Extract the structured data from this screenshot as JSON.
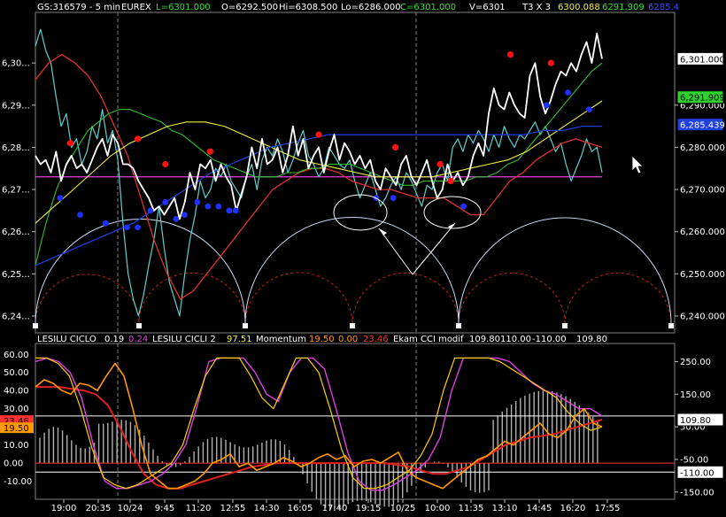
{
  "header": {
    "symbol": "GS:316579 - 5 min",
    "exchange": "EUREX",
    "last": "L=6301.000",
    "open": "O=6292.500",
    "high": "Hi=6308.500",
    "low": "Lo=6286.000",
    "close": "C=6301.000",
    "volume": "V=6301",
    "t3": "T3 X 3",
    "ma1": "6300.088",
    "ma2": "6291.909",
    "ma3": "6285.4"
  },
  "lower_header": {
    "ind1_name": "LESILU CICLO",
    "ind1_val1": "0.19",
    "ind1_val2": "0.24",
    "ind2_name": "LESILU CICLI 2",
    "ind2_val": "97.51",
    "ind3_name": "Momentum",
    "ind3_val1": "19.50",
    "ind3_val2": "0.00",
    "ind3_val3": "23.46",
    "ind4_name": "Ekam CCI modif",
    "ind4_val1": "109.80",
    "ind4_val2": "110.00",
    "ind4_val3": "-110.00",
    "ind4_val4": "109.80"
  },
  "colors": {
    "background": "#000000",
    "price": "#ffffff",
    "price_alt": "#5fd0d0",
    "ma_red": "#e03030",
    "ma_green": "#30c030",
    "ma_yellow": "#f0f040",
    "ma_blue": "#2040e0",
    "magenta": "#e040e0",
    "dot_red": "#ff1010",
    "dot_blue": "#2030ff",
    "arc_white": "#c8d8f0",
    "arc_red": "#c02020",
    "momentum_orange": "#ff9900",
    "cci_gold": "#ffd000",
    "hist_gray": "#b0b0b0"
  },
  "chart_data": [
    {
      "type": "line",
      "panel": "price",
      "x_labels": [
        "19:00",
        "20:35",
        "10/24",
        "9:45",
        "11:20",
        "12:55",
        "14:30",
        "16:05",
        "17:40",
        "19:15",
        "10/25",
        "10:00",
        "11:35",
        "13:10",
        "14:45",
        "16:20",
        "17:55"
      ],
      "y_ticks": [
        "6,30...",
        "6,29...",
        "6,28...",
        "6,27...",
        "6,26...",
        "6,25...",
        "6,24..."
      ],
      "y_right_ticks": [
        "6,290.000",
        "6,280.000",
        "6,270.000",
        "6,260.000",
        "6,250.000",
        "6,240.000"
      ],
      "ylim": [
        6236,
        6312
      ],
      "price_tags": [
        {
          "label": "6,301.000",
          "value": 6301.0,
          "color": "#ffffff",
          "text_color": "#000000"
        },
        {
          "label": "6,291.909",
          "value": 6291.9,
          "color": "#30d030",
          "text_color": "#000000"
        },
        {
          "label": "6,285.439",
          "value": 6285.4,
          "color": "#2040e0",
          "text_color": "#ffffff"
        }
      ],
      "horizontal_line": 6273.0,
      "series": [
        {
          "values": [
            6278,
            6276,
            6277,
            6274,
            6279,
            6272,
            6276,
            6278,
            6275,
            6276,
            6274,
            6277,
            6280,
            6282,
            6278,
            6283,
            6281,
            6276,
            6276,
            6275,
            6272,
            6270,
            6268,
            6265,
            6266,
            6264,
            6266,
            6268,
            6263,
            6267,
            6274,
            6270,
            6276,
            6275,
            6277,
            6272,
            6276,
            6273,
            6271,
            6265,
            6269,
            6273,
            6280,
            6275,
            6282,
            6276,
            6277,
            6280,
            6274,
            6278,
            6285,
            6278,
            6282,
            6275,
            6278,
            6280,
            6274,
            6279,
            6283,
            6277,
            6281,
            6279,
            6276,
            6278,
            6275,
            6277,
            6272,
            6270,
            6275,
            6273,
            6271,
            6276,
            6278,
            6273,
            6271,
            6274,
            6277,
            6272,
            6268,
            6270,
            6276,
            6272,
            6274,
            6271,
            6273,
            6278,
            6281,
            6278,
            6288,
            6294,
            6290,
            6289,
            6293,
            6290,
            6288,
            6287,
            6297,
            6300,
            6292,
            6288,
            6291,
            6295,
            6298,
            6297,
            6300,
            6298,
            6302,
            6305,
            6300,
            6307,
            6301
          ]
        },
        {
          "values": [
            6304,
            6308,
            6303,
            6300,
            6292,
            6285,
            6288,
            6280,
            6282,
            6276,
            6279,
            6285,
            6282,
            6289,
            6281,
            6284,
            6277,
            6262,
            6250,
            6244,
            6240,
            6245,
            6252,
            6258,
            6266,
            6256,
            6248,
            6244,
            6240,
            6250,
            6258,
            6264,
            6272,
            6268,
            6270,
            6275,
            6273,
            6276,
            6272,
            6270,
            6268,
            6273,
            6276,
            6270,
            6277,
            6280,
            6278,
            6282,
            6279,
            6274,
            6277,
            6281,
            6284,
            6278,
            6276,
            6273,
            6275,
            6280,
            6278,
            6276,
            6275,
            6277,
            6272,
            6268,
            6271,
            6274,
            6270,
            6266,
            6268,
            6271,
            6273,
            6270,
            6274,
            6272,
            6269,
            6266,
            6271,
            6270,
            6274,
            6276,
            6272,
            6280,
            6282,
            6279,
            6283,
            6281,
            6284,
            6282,
            6279,
            6283,
            6280,
            6285,
            6282,
            6280,
            6283,
            6282,
            6284,
            6286,
            6283,
            6285,
            6282,
            6279,
            6281,
            6276,
            6272,
            6275,
            6278,
            6282,
            6279,
            6280,
            6274
          ]
        },
        {
          "values": [
            6252,
            6262,
            6270,
            6276,
            6280,
            6284,
            6286,
            6288,
            6289,
            6289,
            6288,
            6287,
            6286,
            6284,
            6283,
            6281,
            6279,
            6277,
            6276,
            6275,
            6274,
            6273,
            6273,
            6273,
            6274,
            6274,
            6275,
            6275,
            6276,
            6276,
            6276,
            6275,
            6274,
            6273,
            6272,
            6271,
            6271,
            6272,
            6272,
            6272,
            6272,
            6272,
            6273,
            6273,
            6274,
            6276,
            6277,
            6280,
            6283,
            6286,
            6289,
            6292,
            6295,
            6298,
            6300
          ]
        },
        {
          "values": [
            6296,
            6300,
            6302,
            6300,
            6297,
            6292,
            6285,
            6278,
            6268,
            6258,
            6250,
            6244,
            6246,
            6250,
            6254,
            6258,
            6262,
            6266,
            6270,
            6272,
            6274,
            6275,
            6275,
            6274,
            6272,
            6271,
            6270,
            6270,
            6269,
            6268,
            6268,
            6268,
            6266,
            6264,
            6264,
            6268,
            6272,
            6274,
            6277,
            6279,
            6281,
            6282,
            6281,
            6280
          ]
        },
        {
          "values": [
            6262,
            6266,
            6270,
            6274,
            6278,
            6281,
            6283,
            6285,
            6286,
            6286,
            6285,
            6283,
            6281,
            6279,
            6277,
            6276,
            6275,
            6274,
            6273,
            6273,
            6273,
            6273,
            6274,
            6275,
            6276,
            6277,
            6279,
            6282,
            6285,
            6288,
            6291
          ]
        },
        {
          "values": [
            6252,
            6254,
            6256,
            6258,
            6260,
            6262,
            6265,
            6268,
            6271,
            6274,
            6276,
            6278,
            6280,
            6281,
            6282,
            6283,
            6283,
            6283,
            6283,
            6283,
            6283,
            6283,
            6283,
            6283,
            6283,
            6283,
            6284,
            6284,
            6285,
            6285
          ]
        }
      ],
      "red_dots": [
        [
          0.082,
          6281
        ],
        [
          0.24,
          6282
        ],
        [
          0.305,
          6276
        ],
        [
          0.41,
          6279
        ],
        [
          0.665,
          6283
        ],
        [
          0.845,
          6280
        ],
        [
          0.95,
          6276
        ],
        [
          0.975,
          6272
        ],
        [
          1.115,
          6302
        ],
        [
          1.21,
          6300
        ]
      ],
      "blue_dots": [
        [
          0.058,
          6268
        ],
        [
          0.105,
          6264
        ],
        [
          0.165,
          6262
        ],
        [
          0.215,
          6261
        ],
        [
          0.24,
          6261
        ],
        [
          0.27,
          6265
        ],
        [
          0.305,
          6267
        ],
        [
          0.33,
          6263
        ],
        [
          0.35,
          6264
        ],
        [
          0.38,
          6267
        ],
        [
          0.405,
          6266
        ],
        [
          0.43,
          6266
        ],
        [
          0.455,
          6265
        ],
        [
          0.47,
          6265
        ],
        [
          0.8,
          6268
        ],
        [
          0.84,
          6268
        ],
        [
          1.005,
          6266
        ],
        [
          1.2,
          6290
        ],
        [
          1.25,
          6293
        ],
        [
          1.3,
          6289
        ]
      ]
    },
    {
      "type": "line",
      "panel": "indicators",
      "left_ticks": [
        "60.00",
        "50.00",
        "40.00",
        "30.00",
        "20.00",
        "10.00",
        "0.00",
        "-10.00"
      ],
      "right_ticks": [
        "250.00",
        "150.00",
        "50.00",
        "-50.00",
        "-150.00"
      ],
      "ylim": [
        -20,
        66
      ],
      "left_tags": [
        {
          "label": "23.46",
          "value": 23.46,
          "color": "#ff3030"
        },
        {
          "label": "19.50",
          "value": 19.5,
          "color": "#ff9900"
        }
      ],
      "right_tags": [
        {
          "label": "109.80",
          "value": 24,
          "color": "#000000"
        },
        {
          "label": "-110.00",
          "value": -5,
          "color": "#000000"
        }
      ],
      "levels": [
        26,
        -5,
        0
      ],
      "series": [
        {
          "values": [
            42,
            46,
            44,
            40,
            38,
            44,
            43,
            40,
            48,
            55,
            48,
            30,
            10,
            -6,
            -10,
            -14,
            -14,
            -12,
            -10,
            -6,
            0,
            2,
            5,
            -2,
            0,
            -4,
            -2,
            0,
            3,
            1,
            -2,
            0,
            3,
            5,
            2,
            4,
            -2,
            1,
            2,
            0,
            3,
            6,
            -4,
            -8,
            -10,
            -12,
            -14,
            -10,
            -6,
            -2,
            2,
            4,
            8,
            12,
            10,
            14,
            18,
            22,
            16,
            14,
            18,
            26,
            30,
            22,
            20
          ]
        },
        {
          "values": [
            42,
            42,
            42,
            41,
            40,
            38,
            32,
            20,
            6,
            -6,
            -12,
            -14,
            -14,
            -12,
            -10,
            -8,
            -6,
            -4,
            -2,
            -1,
            0,
            0,
            0,
            0,
            0,
            0,
            0,
            0,
            0,
            0,
            -1,
            -2,
            -4,
            -6,
            -6,
            -4,
            -2,
            2,
            6,
            10,
            12,
            14,
            15,
            16,
            18,
            20,
            22,
            24
          ]
        },
        {
          "values": [
            58,
            58,
            55,
            48,
            30,
            8,
            -8,
            -12,
            -14,
            -12,
            -8,
            -4,
            0,
            10,
            30,
            48,
            58,
            58,
            58,
            48,
            36,
            30,
            44,
            58,
            58,
            50,
            30,
            8,
            -8,
            -14,
            -14,
            -12,
            -8,
            -4,
            4,
            16,
            40,
            58,
            58,
            58,
            58,
            56,
            52,
            48,
            44,
            40,
            36,
            28,
            22,
            18,
            20
          ]
        },
        {
          "values": [
            56,
            58,
            56,
            50,
            36,
            10,
            -10,
            -14,
            -14,
            -12,
            -10,
            -6,
            0,
            10,
            32,
            56,
            58,
            58,
            58,
            50,
            38,
            34,
            50,
            58,
            58,
            52,
            30,
            6,
            -10,
            -15,
            -15,
            -12,
            -8,
            -4,
            2,
            14,
            40,
            58,
            58,
            58,
            58,
            56,
            50,
            44,
            40,
            38,
            34,
            30,
            30,
            26
          ]
        }
      ],
      "histogram_period": 124
    }
  ]
}
